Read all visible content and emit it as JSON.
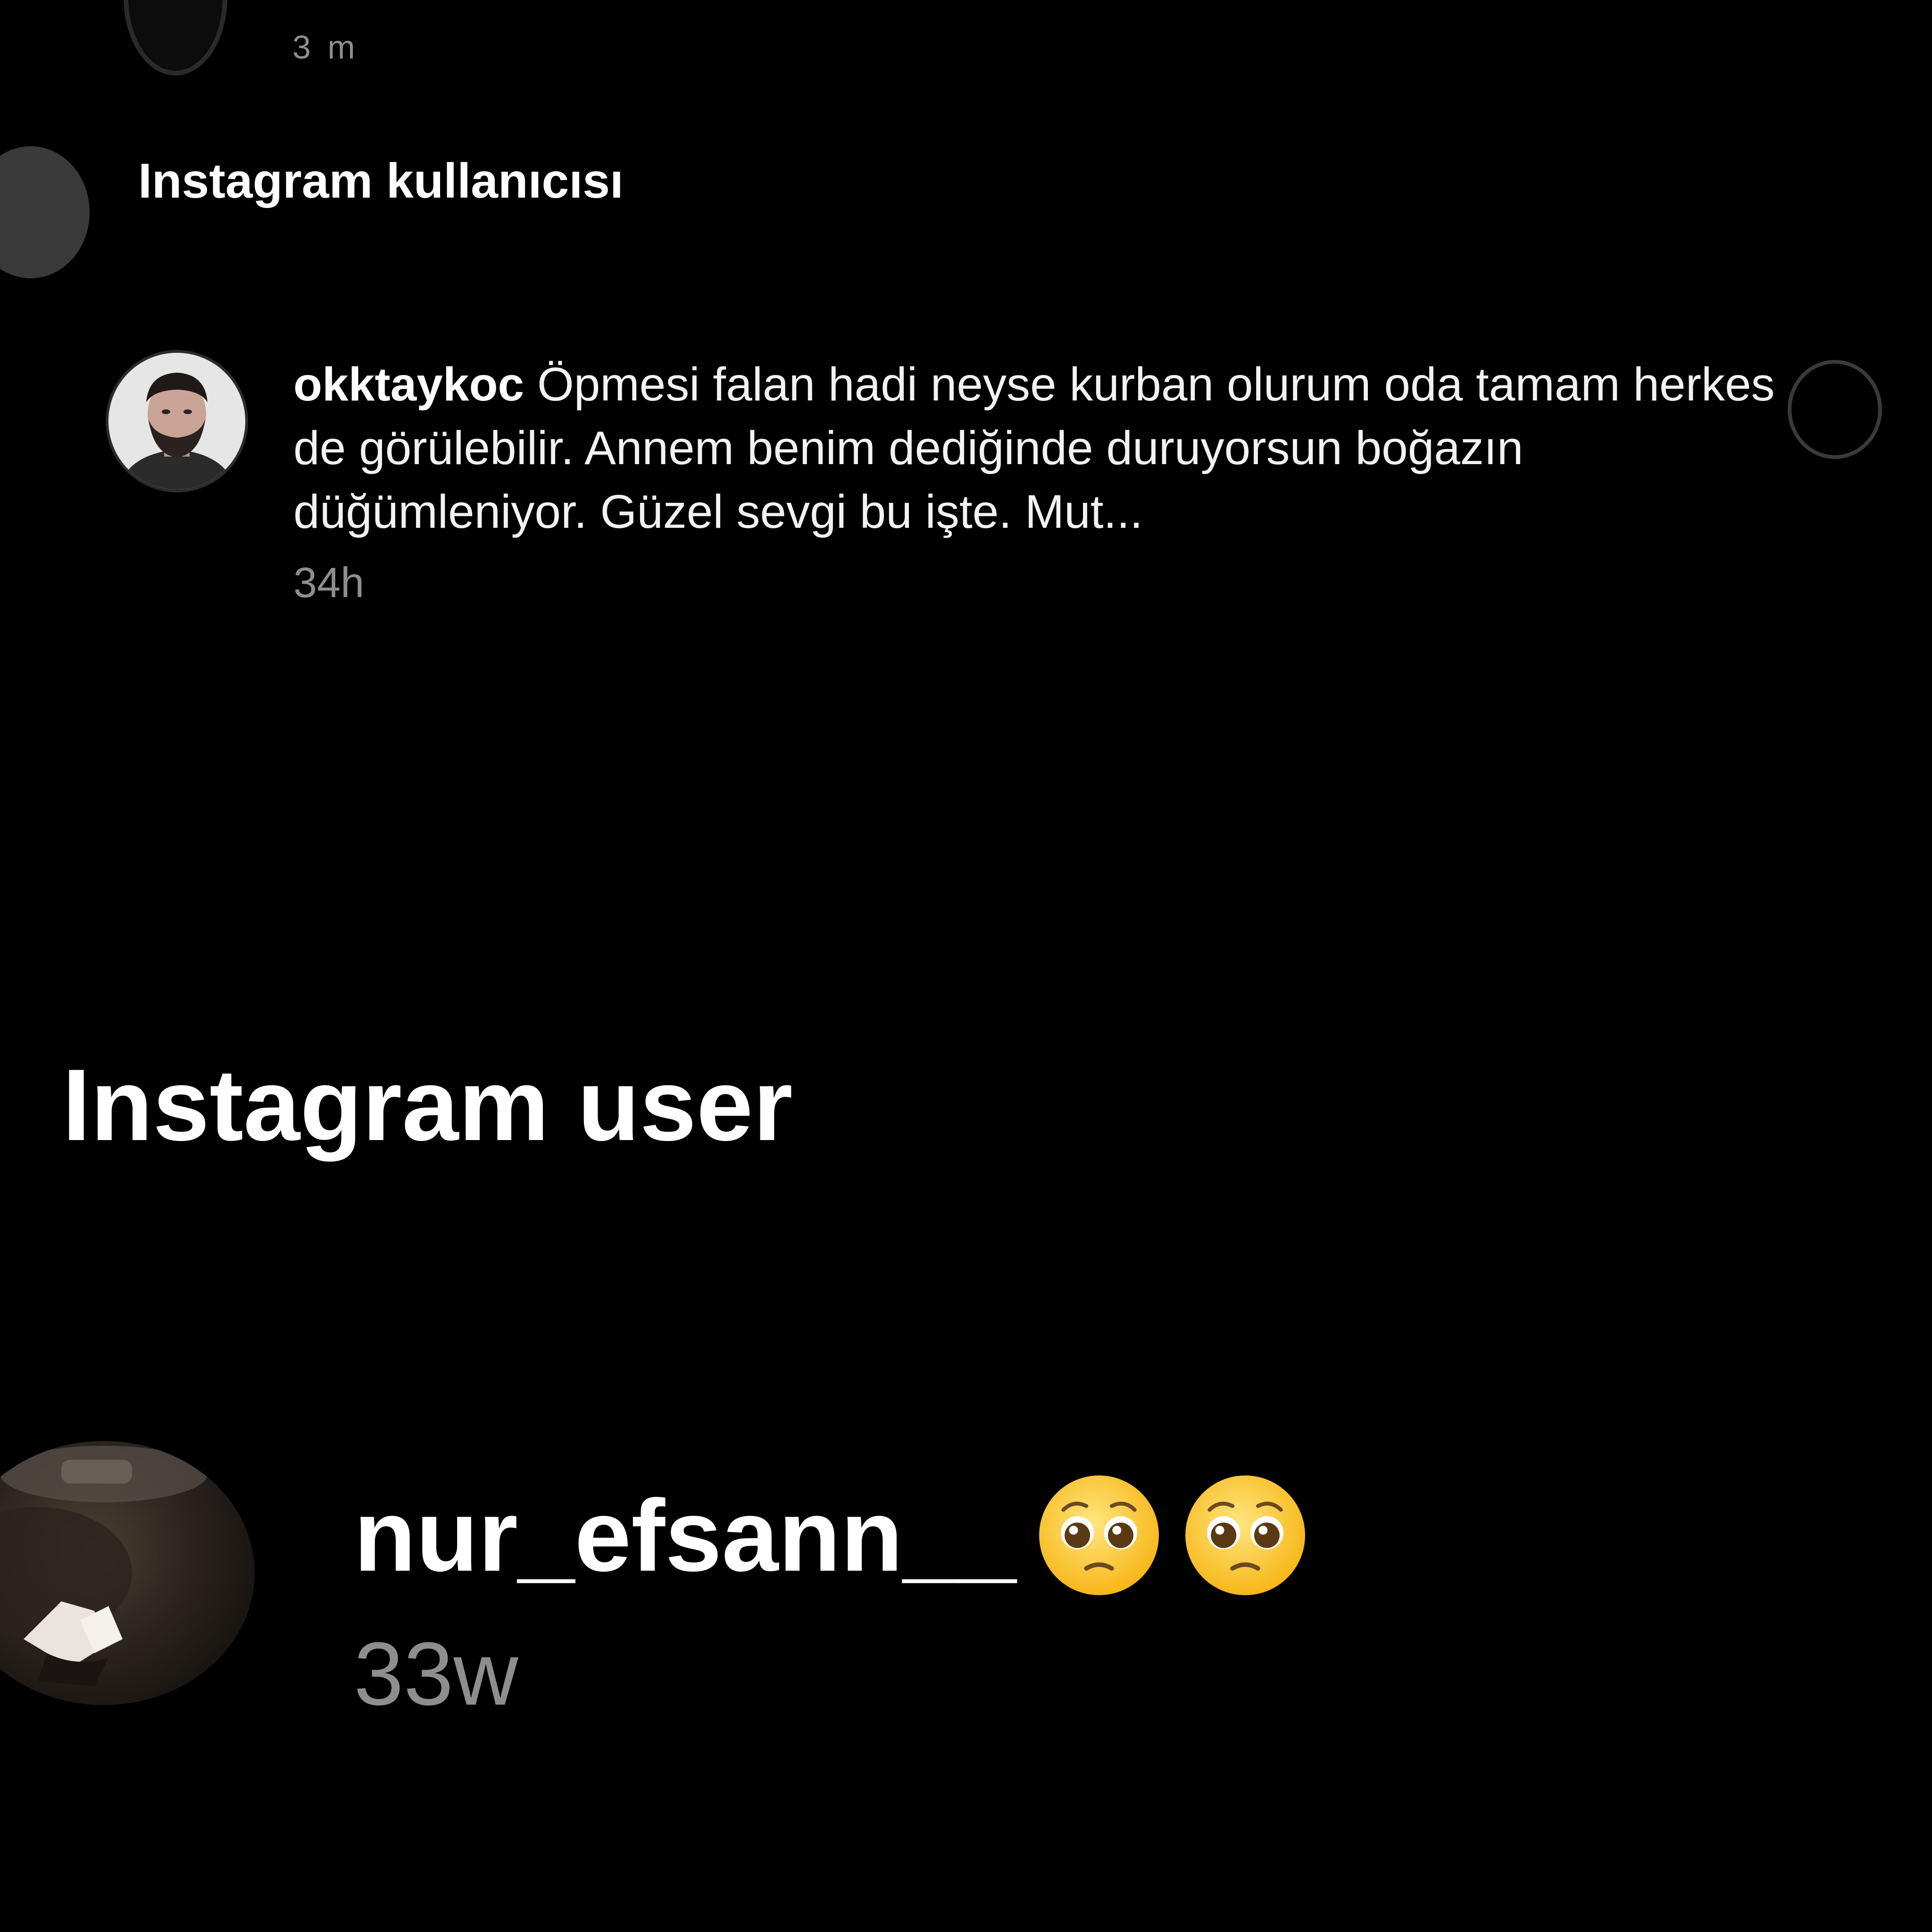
{
  "top": {
    "cut_text": "3 m"
  },
  "small_heading": "Instagram kullanıcısı",
  "comment": {
    "username": "okktaykoc",
    "text": "Öpmesi falan hadi neyse kurban olurum oda tamam herkes de görülebilir. Annem benim dediğinde duruyorsun boğazın düğümleniyor. Güzel sevgi bu işte. Mut...",
    "time": "34h"
  },
  "big_heading": "Instagram user",
  "bottom": {
    "username": "nur_efsann__",
    "time": "33w",
    "emoji_name": "pleading-face"
  },
  "colors": {
    "background": "#000000",
    "text": "#ffffff",
    "muted": "#8e8e8e"
  }
}
